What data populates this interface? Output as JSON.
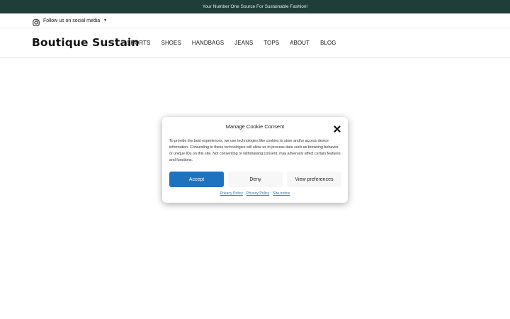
{
  "banner": {
    "text": "Your Number One Source For Sustainable Fashion!"
  },
  "social": {
    "icon": "instagram-icon",
    "label": "Follow us on social media",
    "caret": "▼"
  },
  "header": {
    "brand": "Boutique Sustain",
    "nav": [
      "SHORTS",
      "SHOES",
      "HANDBAGS",
      "JEANS",
      "TOPS",
      "ABOUT",
      "BLOG"
    ]
  },
  "cookie_modal": {
    "title": "Manage Cookie Consent",
    "body": "To provide the best experiences, we use technologies like cookies to store and/or access device information. Consenting to these technologies will allow us to process data such as browsing behavior or unique IDs on this site. Not consenting or withdrawing consent, may adversely affect certain features and functions.",
    "accept_label": "Accept",
    "deny_label": "Deny",
    "preferences_label": "View preferences",
    "links": [
      "Privacy Policy",
      "Privacy Policy",
      "Site notice"
    ]
  },
  "colors": {
    "banner_bg": "#1f3d39",
    "accent": "#1e73be"
  }
}
